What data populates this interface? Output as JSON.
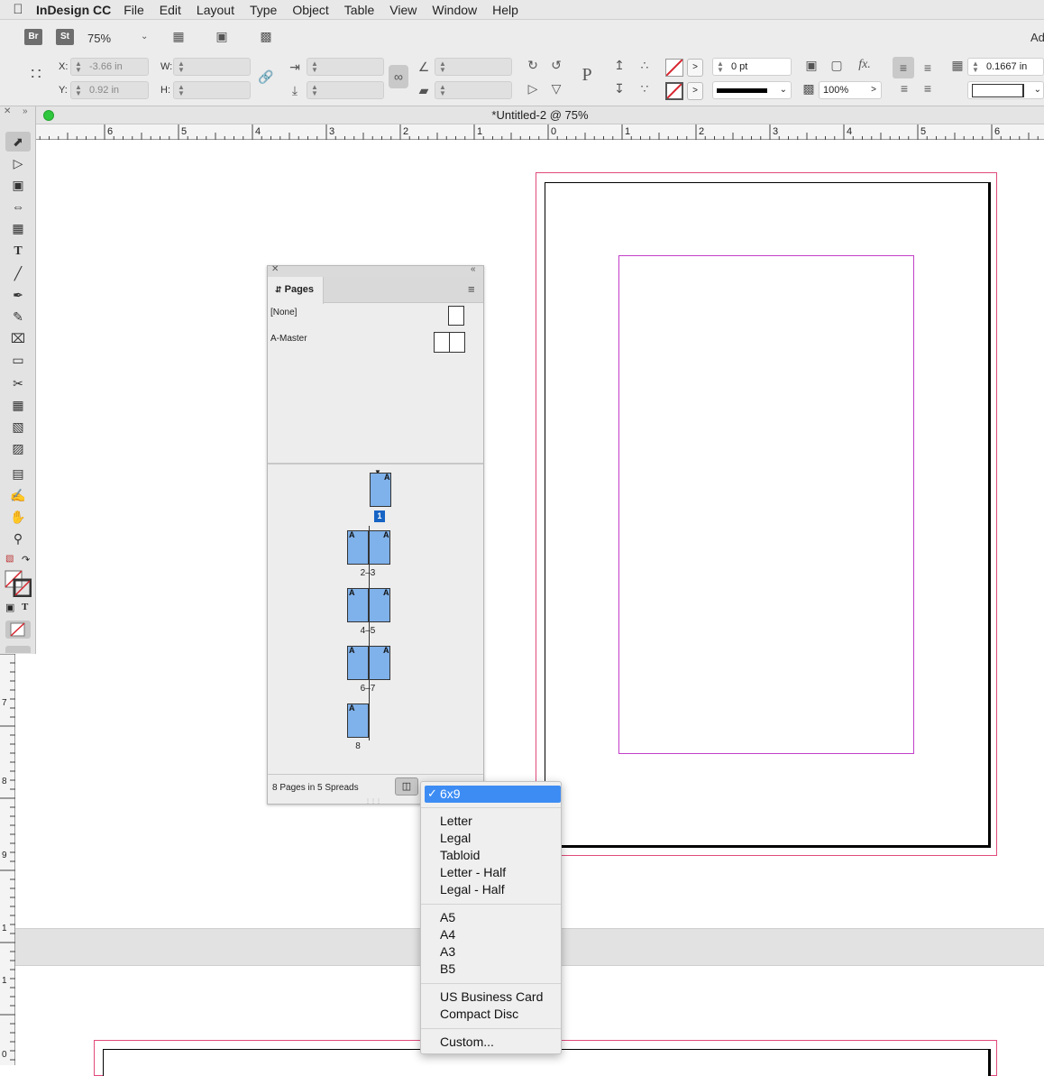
{
  "menubar": {
    "app_name": "InDesign CC",
    "items": [
      "File",
      "Edit",
      "Layout",
      "Type",
      "Object",
      "Table",
      "View",
      "Window",
      "Help"
    ]
  },
  "control_bar": {
    "bridge_label": "Br",
    "stock_label": "St",
    "zoom_value": "75%",
    "x_label": "X:",
    "x_value": "-3.66 in",
    "y_label": "Y:",
    "y_value": "0.92 in",
    "w_label": "W:",
    "h_label": "H:",
    "stroke_weight": "0 pt",
    "opacity": "100%",
    "gutter_value": "0.1667 in",
    "ad_label": "Ad"
  },
  "document": {
    "title": "*Untitled-2 @ 75%",
    "ruler_labels": [
      "6",
      "5",
      "4",
      "3",
      "2",
      "1",
      "0",
      "1",
      "2",
      "3",
      "4",
      "5",
      "6"
    ],
    "vruler_labels": [
      "7",
      "8",
      "9",
      "1",
      "1",
      "0"
    ]
  },
  "pages_panel": {
    "tab_label": "Pages",
    "masters": [
      {
        "label": "[None]"
      },
      {
        "label": "A-Master"
      }
    ],
    "page_numbers": [
      "1",
      "2–3",
      "4–5",
      "6–7",
      "8"
    ],
    "master_letter": "A",
    "status": "8 Pages in 5 Spreads"
  },
  "page_size_menu": {
    "selected": "6x9",
    "groups": [
      [
        "Letter",
        "Legal",
        "Tabloid",
        "Letter - Half",
        "Legal - Half"
      ],
      [
        "A5",
        "A4",
        "A3",
        "B5"
      ],
      [
        "US Business Card",
        "Compact Disc"
      ],
      [
        "Custom..."
      ]
    ]
  },
  "colors": {
    "bleed": "#e04a7a",
    "margin": "#c23fc8",
    "page_thumb": "#7fb1ea",
    "menu_highlight": "#3d8cf4"
  }
}
